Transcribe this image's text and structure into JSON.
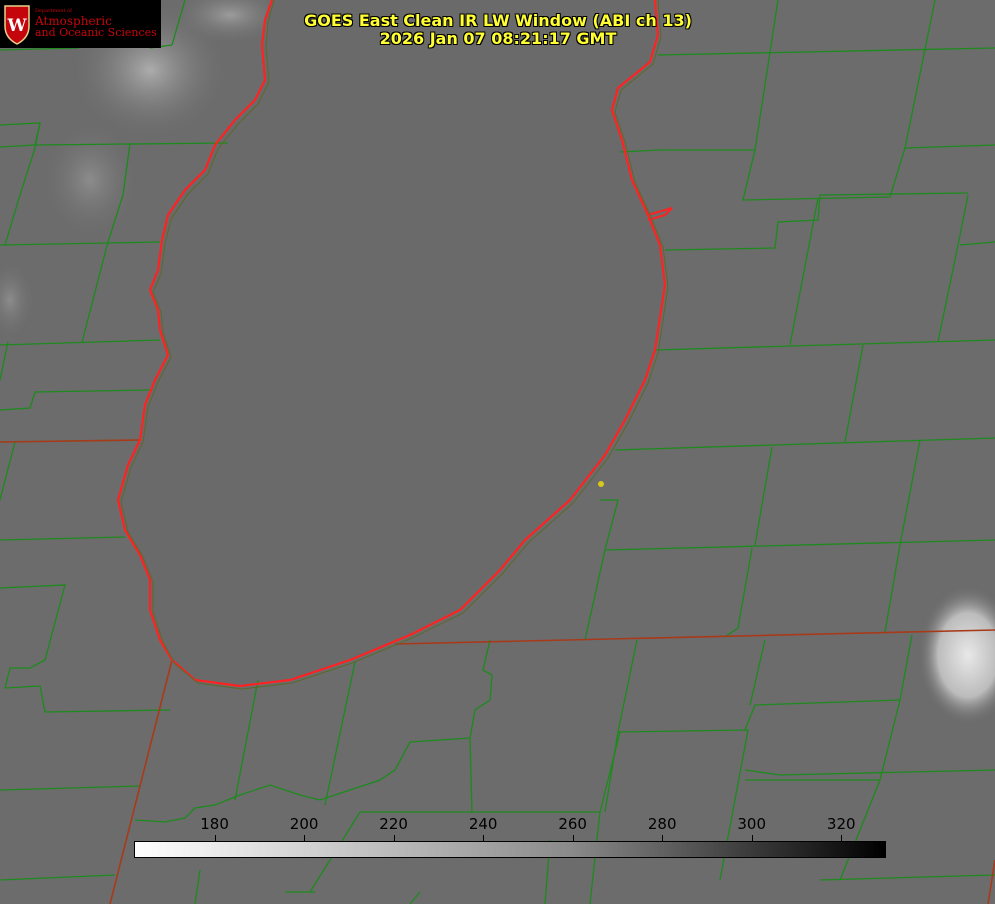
{
  "logo": {
    "dept": "Department of",
    "line1": "Atmospheric",
    "line2": "and Oceanic Sciences"
  },
  "title": {
    "line1": "GOES East Clean IR LW Window (ABI ch 13)",
    "line2": "2026 Jan 07 08:21:17 GMT"
  },
  "colorbar": {
    "ticks": [
      "180",
      "200",
      "220",
      "240",
      "260",
      "280",
      "300",
      "320"
    ],
    "range": [
      162,
      330
    ]
  },
  "colors": {
    "background": "#6c6c6c",
    "county_lines": "#1d8a1d",
    "coastline": "#ff2222",
    "title_text": "#ffff33",
    "logo_text": "#c5050c",
    "marker": "#d8c81a"
  }
}
